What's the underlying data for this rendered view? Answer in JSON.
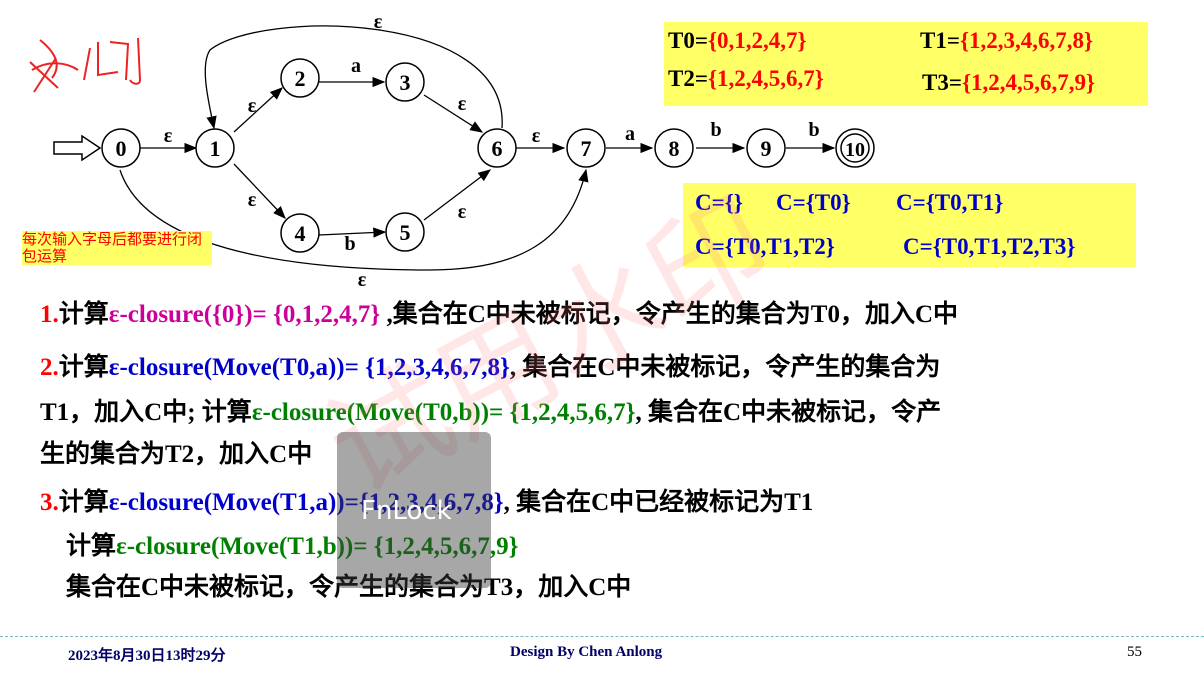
{
  "handwritten_title": "成例",
  "diagram": {
    "states": [
      "0",
      "1",
      "2",
      "3",
      "4",
      "5",
      "6",
      "7",
      "8",
      "9",
      "10"
    ],
    "epsilon": "ε",
    "a": "a",
    "b": "b"
  },
  "sets": {
    "T0_label": "T0=",
    "T0_value": "{0,1,2,4,7}",
    "T1_label": "T1=",
    "T1_value": "{1,2,3,4,6,7,8}",
    "T2_label": "T2=",
    "T2_value": "{1,2,4,5,6,7}",
    "T3_label": "T3=",
    "T3_value": "{1,2,4,5,6,7,9}"
  },
  "c_sets": [
    "C={}",
    "C={T0}",
    "C={T0,T1}",
    "C={T0,T1,T2}",
    "C={T0,T1,T2,T3}"
  ],
  "note": "每次输入字母后都要进行闭包运算",
  "steps": {
    "s1_num": "1.",
    "s1_a": "计算",
    "s1_b": "ε-closure({0})= ",
    "s1_c": "{0,1,2,4,7}",
    "s1_d": " ,集合在C中未被标记，令产生的集合为T0，加入C中",
    "s2_num": "2.",
    "s2_a": "计算",
    "s2_b": "ε-closure(Move(T0,a))= {1,2,3,4,6,7,8}",
    "s2_c": ", 集合在C中未被标记，令产生的集合为",
    "s2_line2_a": "T1，加入C中; 计算",
    "s2_line2_b": "ε-closure(Move(T0,b))= {1,2,4,5,6,7}",
    "s2_line2_c": ", 集合在C中未被标记，令产",
    "s2_line3": "生的集合为T2，加入C中",
    "s3_num": "3.",
    "s3_a": "计算",
    "s3_b": "ε-closure(Move(T1,a))={1,2,3,4,6,7,8}",
    "s3_c": ", 集合在C中已经被标记为T1",
    "s3_line2_a": "计算",
    "s3_line2_b": "ε-closure(Move(T1,b))= {1,2,4,5,6,7,9}",
    "s3_line3": "集合在C中未被标记，令产生的集合为T3，加入C中"
  },
  "footer": {
    "date": "2023年8月30日13时29分",
    "design": "Design By Chen Anlong",
    "page": "55"
  },
  "overlay": {
    "watermark": "试用水印",
    "fnlock": "FnLock"
  }
}
